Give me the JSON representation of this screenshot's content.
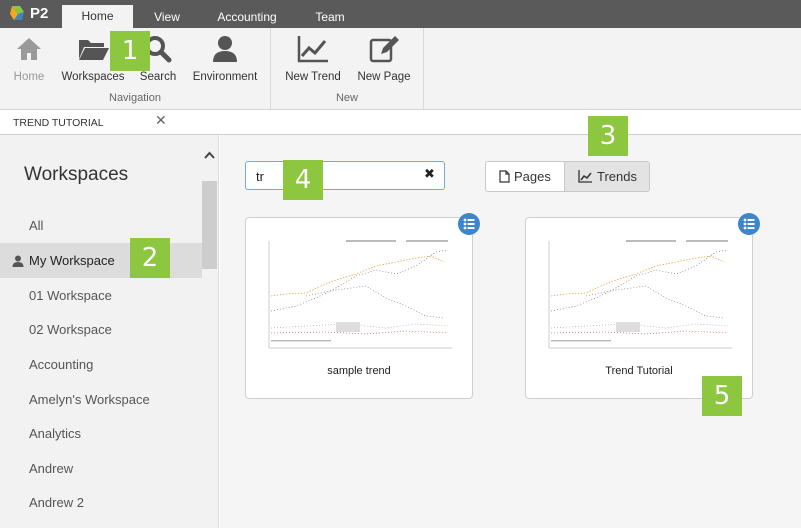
{
  "app": {
    "logo_text": "P2"
  },
  "top_tabs": [
    {
      "label": "Home",
      "active": true
    },
    {
      "label": "View",
      "active": false
    },
    {
      "label": "Accounting",
      "active": false
    },
    {
      "label": "Team",
      "active": false
    }
  ],
  "ribbon": {
    "navigation": {
      "group_label": "Navigation",
      "buttons": [
        {
          "label": "Home",
          "icon": "home-icon",
          "disabled": true
        },
        {
          "label": "Workspaces",
          "icon": "folder-open-icon",
          "disabled": false
        },
        {
          "label": "Search",
          "icon": "search-icon",
          "disabled": false
        },
        {
          "label": "Environment",
          "icon": "user-icon",
          "disabled": false
        }
      ]
    },
    "new": {
      "group_label": "New",
      "buttons": [
        {
          "label": "New Trend",
          "icon": "trend-chart-icon"
        },
        {
          "label": "New Page",
          "icon": "edit-page-icon"
        }
      ]
    }
  },
  "doc_tab": {
    "label": "TREND TUTORIAL",
    "close": "✕"
  },
  "sidebar": {
    "title": "Workspaces",
    "items": [
      {
        "label": "All",
        "selected": false
      },
      {
        "label": "My Workspace",
        "selected": true
      },
      {
        "label": "01 Workspace",
        "selected": false
      },
      {
        "label": "02 Workspace",
        "selected": false
      },
      {
        "label": "Accounting",
        "selected": false
      },
      {
        "label": "Amelyn's Workspace",
        "selected": false
      },
      {
        "label": "Analytics",
        "selected": false
      },
      {
        "label": "Andrew",
        "selected": false
      },
      {
        "label": "Andrew 2",
        "selected": false
      }
    ]
  },
  "search": {
    "value": "tr",
    "clear": "✖"
  },
  "view_toggle": {
    "pages_label": "Pages",
    "trends_label": "Trends",
    "selected": "Trends"
  },
  "cards": [
    {
      "label": "sample trend"
    },
    {
      "label": "Trend Tutorial"
    }
  ],
  "callouts": [
    "1",
    "2",
    "3",
    "4",
    "5"
  ],
  "colors": {
    "accent": "#8dc63f",
    "menu_badge": "#3d86cc",
    "topbar": "#5a5a5a"
  }
}
